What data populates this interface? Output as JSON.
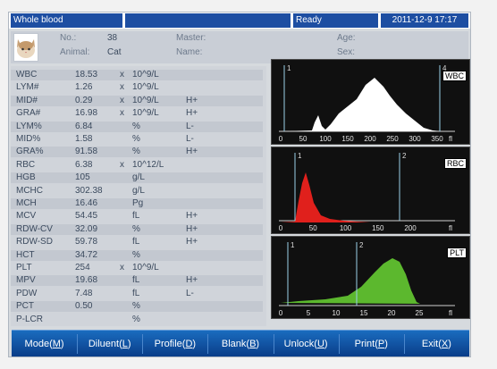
{
  "status_bar": {
    "mode": "Whole blood",
    "status": "Ready",
    "datetime": "2011-12-9 17:17"
  },
  "patient": {
    "no_label": "No.:",
    "no_value": "38",
    "animal_label": "Animal:",
    "animal_value": "Cat",
    "master_label": "Master:",
    "name_label": "Name:",
    "age_label": "Age:",
    "sex_label": "Sex:"
  },
  "results": [
    {
      "name": "WBC",
      "value": "18.53",
      "x": "x",
      "unit": "10^9/L",
      "flag": ""
    },
    {
      "name": "LYM#",
      "value": "1.26",
      "x": "x",
      "unit": "10^9/L",
      "flag": ""
    },
    {
      "name": "MID#",
      "value": "0.29",
      "x": "x",
      "unit": "10^9/L",
      "flag": "H+"
    },
    {
      "name": "GRA#",
      "value": "16.98",
      "x": "x",
      "unit": "10^9/L",
      "flag": "H+"
    },
    {
      "name": "LYM%",
      "value": "6.84",
      "x": "",
      "unit": "%",
      "flag": "L-"
    },
    {
      "name": "MID%",
      "value": "1.58",
      "x": "",
      "unit": "%",
      "flag": "L-"
    },
    {
      "name": "GRA%",
      "value": "91.58",
      "x": "",
      "unit": "%",
      "flag": "H+"
    },
    {
      "name": "RBC",
      "value": "6.38",
      "x": "x",
      "unit": "10^12/L",
      "flag": ""
    },
    {
      "name": "HGB",
      "value": "105",
      "x": "",
      "unit": "g/L",
      "flag": ""
    },
    {
      "name": "MCHC",
      "value": "302.38",
      "x": "",
      "unit": "g/L",
      "flag": ""
    },
    {
      "name": "MCH",
      "value": "16.46",
      "x": "",
      "unit": "Pg",
      "flag": ""
    },
    {
      "name": "MCV",
      "value": "54.45",
      "x": "",
      "unit": "fL",
      "flag": "H+"
    },
    {
      "name": "RDW-CV",
      "value": "32.09",
      "x": "",
      "unit": "%",
      "flag": "H+"
    },
    {
      "name": "RDW-SD",
      "value": "59.78",
      "x": "",
      "unit": "fL",
      "flag": "H+"
    },
    {
      "name": "HCT",
      "value": "34.72",
      "x": "",
      "unit": "%",
      "flag": ""
    },
    {
      "name": "PLT",
      "value": "254",
      "x": "x",
      "unit": "10^9/L",
      "flag": ""
    },
    {
      "name": "MPV",
      "value": "19.68",
      "x": "",
      "unit": "fL",
      "flag": "H+"
    },
    {
      "name": "PDW",
      "value": "7.48",
      "x": "",
      "unit": "fL",
      "flag": "L-"
    },
    {
      "name": "PCT",
      "value": "0.50",
      "x": "",
      "unit": "%",
      "flag": ""
    },
    {
      "name": "P-LCR",
      "value": "",
      "x": "",
      "unit": "%",
      "flag": ""
    }
  ],
  "histograms": [
    {
      "label": "WBC",
      "fill": "#ffffff",
      "ticks": [
        "0",
        "50",
        "100",
        "150",
        "200",
        "250",
        "300",
        "350",
        "fl"
      ],
      "markers": [
        "1",
        "4"
      ]
    },
    {
      "label": "RBC",
      "fill": "#e0201c",
      "ticks": [
        "0",
        "50",
        "100",
        "150",
        "200",
        "fl"
      ],
      "markers": [
        "1",
        "2"
      ]
    },
    {
      "label": "PLT",
      "fill": "#5cb82e",
      "ticks": [
        "0",
        "5",
        "10",
        "15",
        "20",
        "25",
        "fl"
      ],
      "markers": [
        "1",
        "2"
      ]
    }
  ],
  "toolbar": {
    "buttons": [
      {
        "label": "Mode",
        "key": "M"
      },
      {
        "label": "Diluent",
        "key": "L"
      },
      {
        "label": "Profile",
        "key": "D"
      },
      {
        "label": "Blank",
        "key": "B"
      },
      {
        "label": "Unlock",
        "key": "U"
      },
      {
        "label": "Print",
        "key": "P"
      },
      {
        "label": "Exit",
        "key": "X"
      }
    ]
  }
}
